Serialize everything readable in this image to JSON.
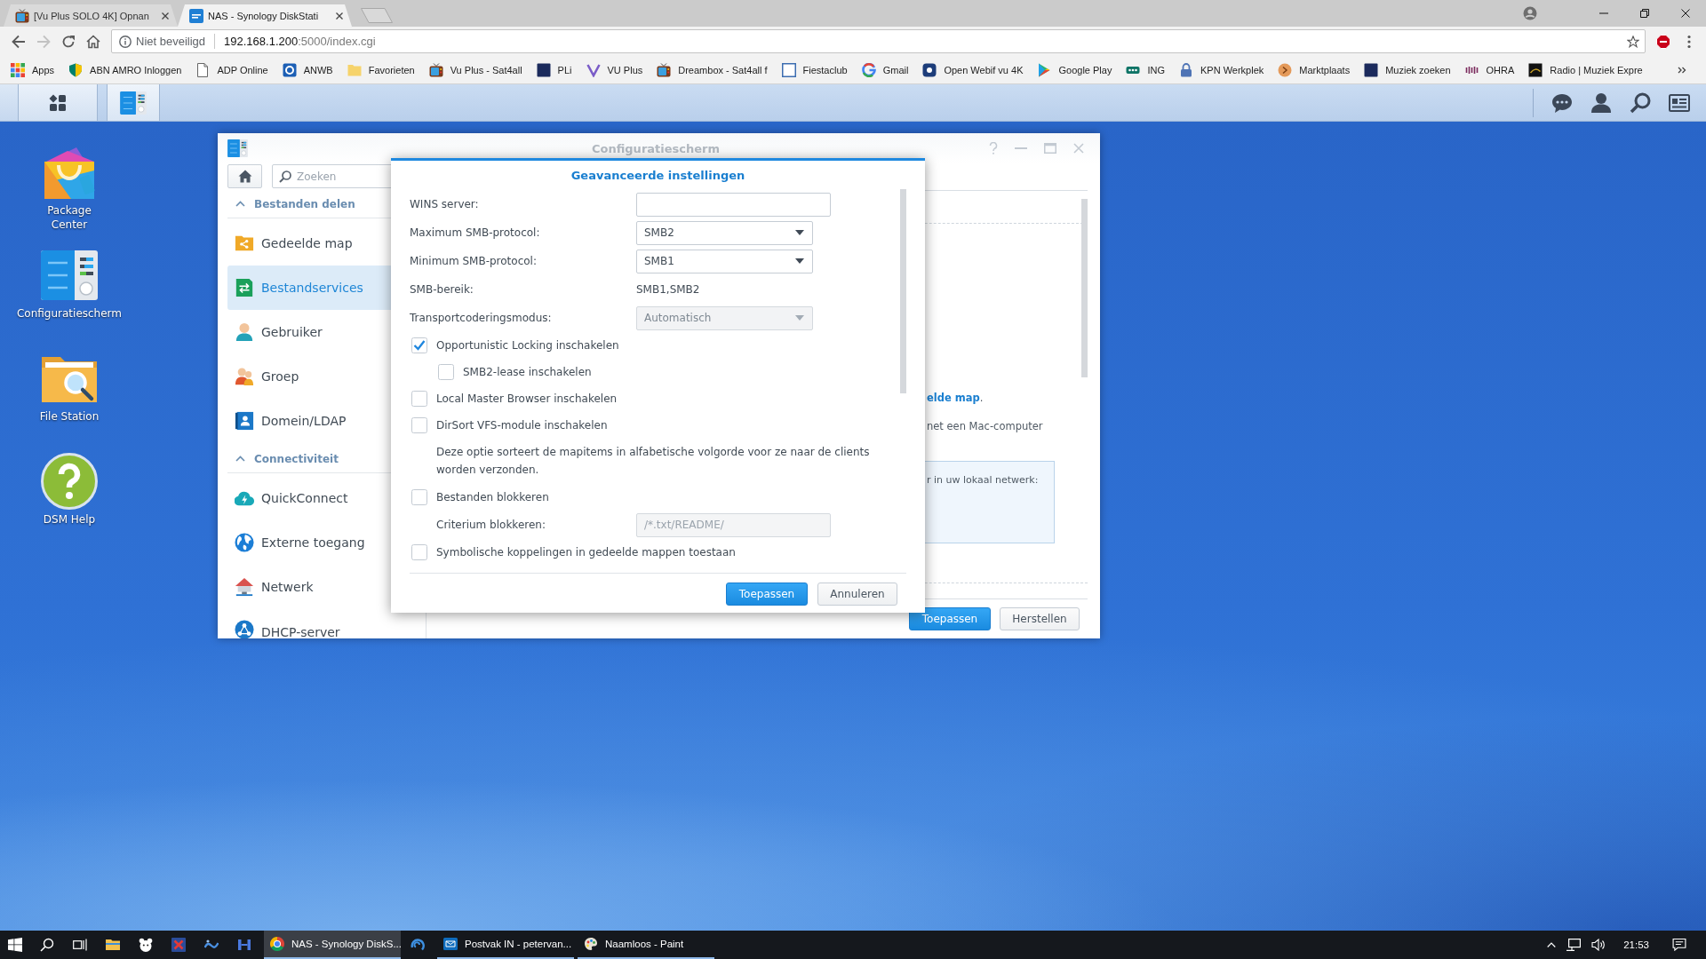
{
  "browser": {
    "tabs": [
      {
        "title": "[Vu Plus SOLO 4K] Opnan",
        "kind": "tv",
        "selected": false
      },
      {
        "title": "NAS - Synology DiskStati",
        "kind": "dsm",
        "selected": true
      }
    ],
    "navigation": {
      "forward_disabled": true
    },
    "address": {
      "security": "Niet beveiligd",
      "host": "192.168.1.200",
      "path": ":5000/index.cgi"
    },
    "bookmarks": [
      {
        "label": "Apps",
        "kind": "apps"
      },
      {
        "label": "ABN AMRO Inloggen",
        "kind": "shield"
      },
      {
        "label": "ADP Online",
        "kind": "page"
      },
      {
        "label": "ANWB",
        "kind": "circle-tile"
      },
      {
        "label": "Favorieten",
        "kind": "folder"
      },
      {
        "label": "Vu Plus - Sat4all",
        "kind": "tv"
      },
      {
        "label": "PLi",
        "kind": "square"
      },
      {
        "label": "VU Plus",
        "kind": "v-shape"
      },
      {
        "label": "Dreambox - Sat4all f",
        "kind": "tv"
      },
      {
        "label": "Fiestaclub",
        "kind": "square-outline"
      },
      {
        "label": "Gmail",
        "kind": "ring"
      },
      {
        "label": "Open Webif vu 4K",
        "kind": "rounded-square"
      },
      {
        "label": "Google Play",
        "kind": "play"
      },
      {
        "label": "ING",
        "kind": "pill"
      },
      {
        "label": "KPN Werkplek",
        "kind": "lock"
      },
      {
        "label": "Marktplaats",
        "kind": "coin"
      },
      {
        "label": "Muziek zoeken",
        "kind": "square"
      },
      {
        "label": "OHRA",
        "kind": "bars"
      },
      {
        "label": "Radio | Muziek Expre",
        "kind": "thumbnail"
      }
    ]
  },
  "desktop": {
    "shortcuts": [
      {
        "label": "Package Center",
        "kind": "package"
      },
      {
        "label": "Configuratiescherm",
        "kind": "control-panel"
      },
      {
        "label": "File Station",
        "kind": "file-station"
      },
      {
        "label": "DSM Help",
        "kind": "help"
      }
    ]
  },
  "control_panel": {
    "title": "Configuratiescherm",
    "search": {
      "placeholder": "Zoeken"
    },
    "sidebar": [
      {
        "heading": "Bestanden delen",
        "expanded": true,
        "items": [
          {
            "label": "Gedeelde map",
            "kind": "shared-folder",
            "selected": false
          },
          {
            "label": "Bestandservices",
            "kind": "file-services",
            "selected": true
          },
          {
            "label": "Gebruiker",
            "kind": "user",
            "selected": false
          },
          {
            "label": "Groep",
            "kind": "group",
            "selected": false
          },
          {
            "label": "Domein/LDAP",
            "kind": "domain",
            "selected": false
          }
        ]
      },
      {
        "heading": "Connectiviteit",
        "expanded": true,
        "items": [
          {
            "label": "QuickConnect",
            "kind": "quickconnect",
            "selected": false
          },
          {
            "label": "Externe toegang",
            "kind": "external-access",
            "selected": false
          },
          {
            "label": "Netwerk",
            "kind": "network",
            "selected": false
          },
          {
            "label": "DHCP-server",
            "kind": "dhcp",
            "selected": false
          }
        ]
      }
    ],
    "content": {
      "link": "elde map",
      "link_suffix": ".",
      "line": "net een Mac-computer",
      "info": "r in uw lokaal netwerk:"
    },
    "buttons": [
      {
        "label": "Toepassen",
        "kind": "primary"
      },
      {
        "label": "Herstellen",
        "kind": "secondary"
      }
    ]
  },
  "dialog": {
    "title": "Geavanceerde instellingen",
    "fields": [
      {
        "kind": "input",
        "label": "WINS server:",
        "disabled": false
      },
      {
        "kind": "select",
        "label": "Maximum SMB-protocol:",
        "value": "SMB2",
        "disabled": false
      },
      {
        "kind": "select",
        "label": "Minimum SMB-protocol:",
        "value": "SMB1",
        "disabled": false
      },
      {
        "kind": "text",
        "label": "SMB-bereik:",
        "value": "SMB1,SMB2"
      },
      {
        "kind": "select",
        "label": "Transportcoderingsmodus:",
        "value": "Automatisch",
        "disabled": true
      },
      {
        "kind": "checkbox",
        "label": "Opportunistic Locking inschakelen",
        "checked": true,
        "children": [
          {
            "kind": "checkbox",
            "label": "SMB2-lease inschakelen",
            "checked": false
          }
        ]
      },
      {
        "kind": "checkbox",
        "label": "Local Master Browser inschakelen",
        "checked": false
      },
      {
        "kind": "checkbox",
        "label": "DirSort VFS-module inschakelen",
        "checked": false,
        "note": "Deze optie sorteert de mapitems in alfabetische volgorde voor ze naar de clients worden verzonden."
      },
      {
        "kind": "checkbox",
        "label": "Bestanden blokkeren",
        "checked": false,
        "children": [
          {
            "kind": "input",
            "label": "Criterium blokkeren:",
            "placeholder": "/*.txt/README/",
            "disabled": true
          }
        ]
      },
      {
        "kind": "checkbox",
        "label": "Symbolische koppelingen in gedeelde mappen toestaan",
        "checked": false
      }
    ],
    "buttons": [
      {
        "label": "Toepassen",
        "kind": "primary"
      },
      {
        "label": "Annuleren",
        "kind": "secondary"
      }
    ]
  },
  "taskbar": {
    "windows": [
      {
        "title": "NAS - Synology DiskS...",
        "kind": "browser",
        "selected": true
      },
      {
        "title": "Postvak IN - petervan...",
        "kind": "mail",
        "selected": false
      },
      {
        "title": "Naamloos - Paint",
        "kind": "paint",
        "selected": false
      }
    ],
    "clock": "21:53"
  }
}
